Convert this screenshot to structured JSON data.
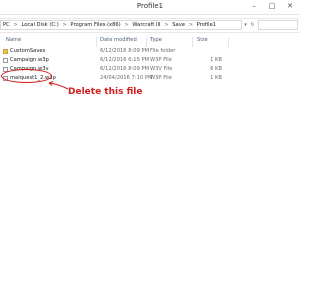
{
  "window": {
    "title": "Profile1",
    "controls": [
      "–",
      "□",
      "✕"
    ]
  },
  "address_bar": {
    "breadcrumbs": [
      "PC",
      "Local Disk (C:)",
      "Program Files (x86)",
      "Warcraft III",
      "Save",
      "Profile1"
    ],
    "separator": ">",
    "search_placeholder": ""
  },
  "columns": {
    "name": "Name",
    "date": "Date modified",
    "type": "Type",
    "size": "Size"
  },
  "files": [
    {
      "icon": "folder-icon",
      "name": "CustomSaves",
      "date": "6/12/2016 8:09 PM",
      "type": "File folder",
      "size": ""
    },
    {
      "icon": "file-icon",
      "name": "Campaign.w3p",
      "date": "6/12/2016 6:15 PM",
      "type": "W3P File",
      "size": "1 KB"
    },
    {
      "icon": "file-icon",
      "name": "Campaign.w3v",
      "date": "6/12/2016 8:09 PM",
      "type": "W3V File",
      "size": "6 KB"
    },
    {
      "icon": "file-icon",
      "name": "malquest1_2.w3p",
      "date": "24/04/2016 7:10 PM",
      "type": "W3P File",
      "size": "1 KB"
    }
  ],
  "annotation": {
    "text": "Delete this file",
    "color": "#d21d1d"
  }
}
